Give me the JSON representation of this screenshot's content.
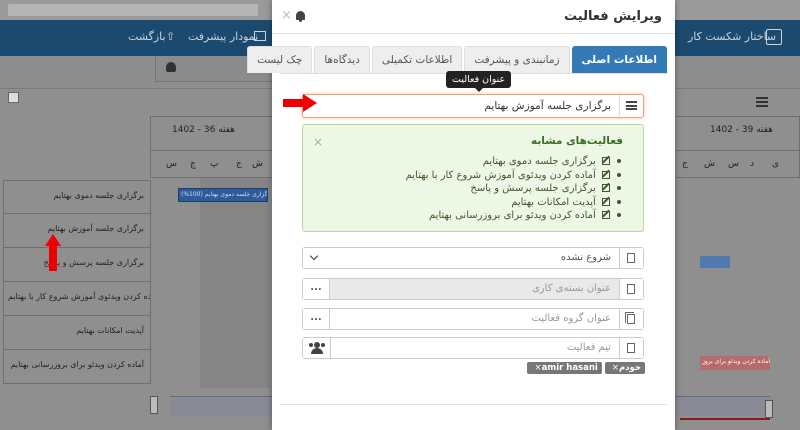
{
  "background": {
    "nav": {
      "items": [
        {
          "label": "ساختار شکست کار",
          "icon": "hierarchy-icon"
        },
        {
          "label": "نمودار پیشرفت",
          "icon": "chart-line-icon"
        },
        {
          "label": "بازگشت",
          "icon": "back-arrow-icon"
        }
      ]
    },
    "gantt": {
      "weeks": [
        "هفته 36 - 1402",
        "هفته 39 - 1402"
      ],
      "days_left": [
        "ش",
        "ج",
        "پ",
        "چ",
        "س"
      ],
      "days_right": [
        "ش",
        "ج",
        "پ",
        "چ",
        "س",
        "د",
        "ی"
      ],
      "rows": [
        "برگزاری جلسه دموی بهتایم",
        "برگزاری جلسه آموزش بهتایم",
        "برگزاری جلسه پرسش و پاسخ",
        "آماده کردن ویدئوی آموزش شروع کار با بهتایم",
        "آپدیت امکانات بهتایم",
        "آماده کردن ویدئو برای بروزرسانی بهتایم"
      ],
      "bar_label": "برگزاری جلسه دموی بهتایم (100%)",
      "bar_right_label": "آماده کردن ویدئو برای بروز..."
    }
  },
  "modal": {
    "title": "ویرایش فعالیت",
    "close": "×",
    "tabs": [
      {
        "label": "اطلاعات اصلی",
        "active": true
      },
      {
        "label": "زمانبندی و پیشرفت",
        "active": false
      },
      {
        "label": "اطلاعات تکمیلی",
        "active": false
      },
      {
        "label": "دیدگاه‌ها",
        "active": false
      },
      {
        "label": "چک لیست",
        "active": false
      }
    ],
    "tooltip": "عنوان فعالیت",
    "activity_name": "برگزاری جلسه آموزش بهتایم",
    "similar": {
      "title": "فعالیت‌های مشابه",
      "close": "×",
      "items": [
        "برگزاری جلسه دموی بهتایم",
        "آماده کردن ویدئوی آموزش شروع کار با بهتایم",
        "برگزاری جلسه پرسش و پاسخ",
        "آپدیت امکانات بهتایم",
        "آماده کردن ویدئو برای بروزرسانی بهتایم"
      ]
    },
    "status": {
      "value": "شروع نشده"
    },
    "work_package": {
      "placeholder": "عنوان بسته‌ی کاری",
      "button": "..."
    },
    "activity_group": {
      "placeholder": "عنوان گروه فعالیت",
      "button": "..."
    },
    "team": {
      "placeholder": "تیم فعالیت"
    },
    "tags": [
      {
        "label": "خودم",
        "remove": "×"
      },
      {
        "label": "amir hasani",
        "remove": "×"
      }
    ]
  }
}
